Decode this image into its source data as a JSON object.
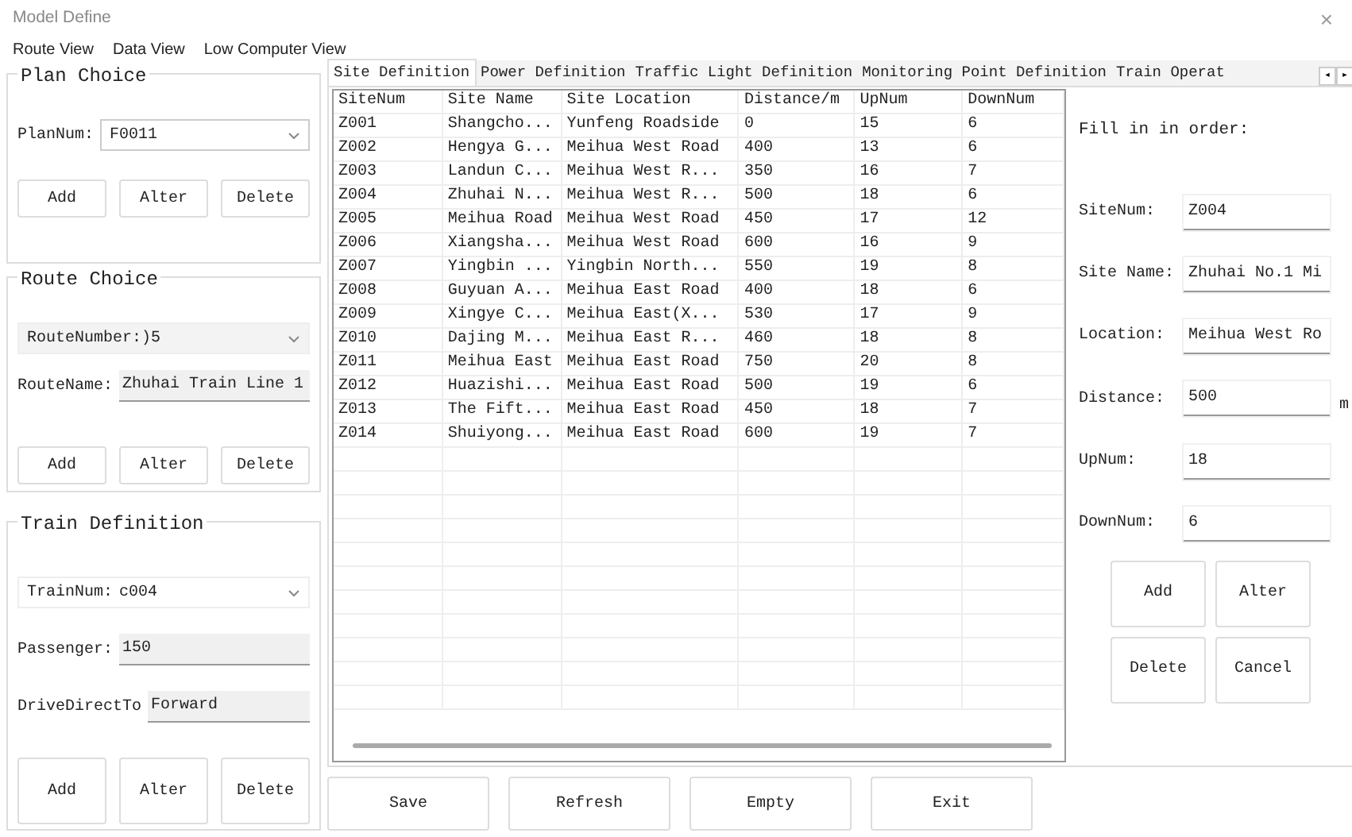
{
  "window": {
    "title": "Model Define",
    "close": "×"
  },
  "menu": [
    {
      "label": "Route View"
    },
    {
      "label": "Data View"
    },
    {
      "label": "Low Computer View"
    }
  ],
  "plan_choice": {
    "title": "Plan Choice",
    "fields": [
      {
        "kind": "combo",
        "label": "PlanNum:",
        "value": "F0011"
      }
    ],
    "buttons": [
      "Add",
      "Alter",
      "Delete"
    ]
  },
  "route_choice": {
    "title": "Route Choice",
    "fields": [
      {
        "kind": "combo",
        "label": "RouteNumber:",
        "value": ")5"
      },
      {
        "kind": "text",
        "label": "RouteName:",
        "value": "Zhuhai Train Line 1"
      }
    ],
    "buttons": [
      "Add",
      "Alter",
      "Delete"
    ]
  },
  "train_definition": {
    "title": "Train Definition",
    "fields": [
      {
        "kind": "combo",
        "label": "TrainNum:",
        "value": "c004"
      },
      {
        "kind": "text",
        "label": "Passenger:",
        "value": "150"
      },
      {
        "kind": "text",
        "label": "DriveDirectTo",
        "value": "Forward"
      }
    ],
    "buttons": [
      "Add",
      "Alter",
      "Delete"
    ]
  },
  "tabs": [
    {
      "label": "Site Definition",
      "selected": true
    },
    {
      "label": "Power Definition",
      "selected": false
    },
    {
      "label": "Traffic Light Definition",
      "selected": false
    },
    {
      "label": "Monitoring Point Definition",
      "selected": false
    },
    {
      "label": "Train Operat",
      "selected": false
    }
  ],
  "tab_scroll": [
    "◂",
    "▸"
  ],
  "table": {
    "columns": [
      "SiteNum",
      "Site Name",
      "Site Location",
      "Distance/m",
      "UpNum",
      "DownNum"
    ],
    "rows": [
      [
        "Z001",
        "Shangcho...",
        "Yunfeng Roadside",
        "0",
        "15",
        "6"
      ],
      [
        "Z002",
        "Hengya G...",
        "Meihua West Road",
        "400",
        "13",
        "6"
      ],
      [
        "Z003",
        "Landun C...",
        "Meihua West R...",
        "350",
        "16",
        "7"
      ],
      [
        "Z004",
        "Zhuhai N...",
        "Meihua West R...",
        "500",
        "18",
        "6"
      ],
      [
        "Z005",
        "Meihua Road",
        "Meihua West Road",
        "450",
        "17",
        "12"
      ],
      [
        "Z006",
        "Xiangsha...",
        "Meihua West Road",
        "600",
        "16",
        "9"
      ],
      [
        "Z007",
        "Yingbin ...",
        "Yingbin North...",
        "550",
        "19",
        "8"
      ],
      [
        "Z008",
        "Guyuan A...",
        "Meihua East Road",
        "400",
        "18",
        "6"
      ],
      [
        "Z009",
        "Xingye C...",
        "Meihua East(X...",
        "530",
        "17",
        "9"
      ],
      [
        "Z010",
        "Dajing M...",
        "Meihua East R...",
        "460",
        "18",
        "8"
      ],
      [
        "Z011",
        "Meihua East",
        "Meihua East Road",
        "750",
        "20",
        "8"
      ],
      [
        "Z012",
        "Huazishi...",
        "Meihua East Road",
        "500",
        "19",
        "6"
      ],
      [
        "Z013",
        "The Fift...",
        "Meihua East Road",
        "450",
        "18",
        "7"
      ],
      [
        "Z014",
        "Shuiyong...",
        "Meihua East Road",
        "600",
        "19",
        "7"
      ]
    ]
  },
  "form": {
    "hint": "Fill in in order:",
    "fields": [
      {
        "label": "SiteNum:",
        "value": "Z004"
      },
      {
        "label": "Site Name:",
        "value": "Zhuhai No.1 Mi"
      },
      {
        "label": "Location:",
        "value": "Meihua West Ro"
      },
      {
        "label": "Distance:",
        "value": "500",
        "unit": "m"
      },
      {
        "label": "UpNum:",
        "value": "18"
      },
      {
        "label": "DownNum:",
        "value": "6"
      }
    ],
    "buttons": [
      "Add",
      "Alter",
      "Delete",
      "Cancel"
    ]
  },
  "bottom_buttons": [
    "Save",
    "Refresh",
    "Empty",
    "Exit"
  ]
}
